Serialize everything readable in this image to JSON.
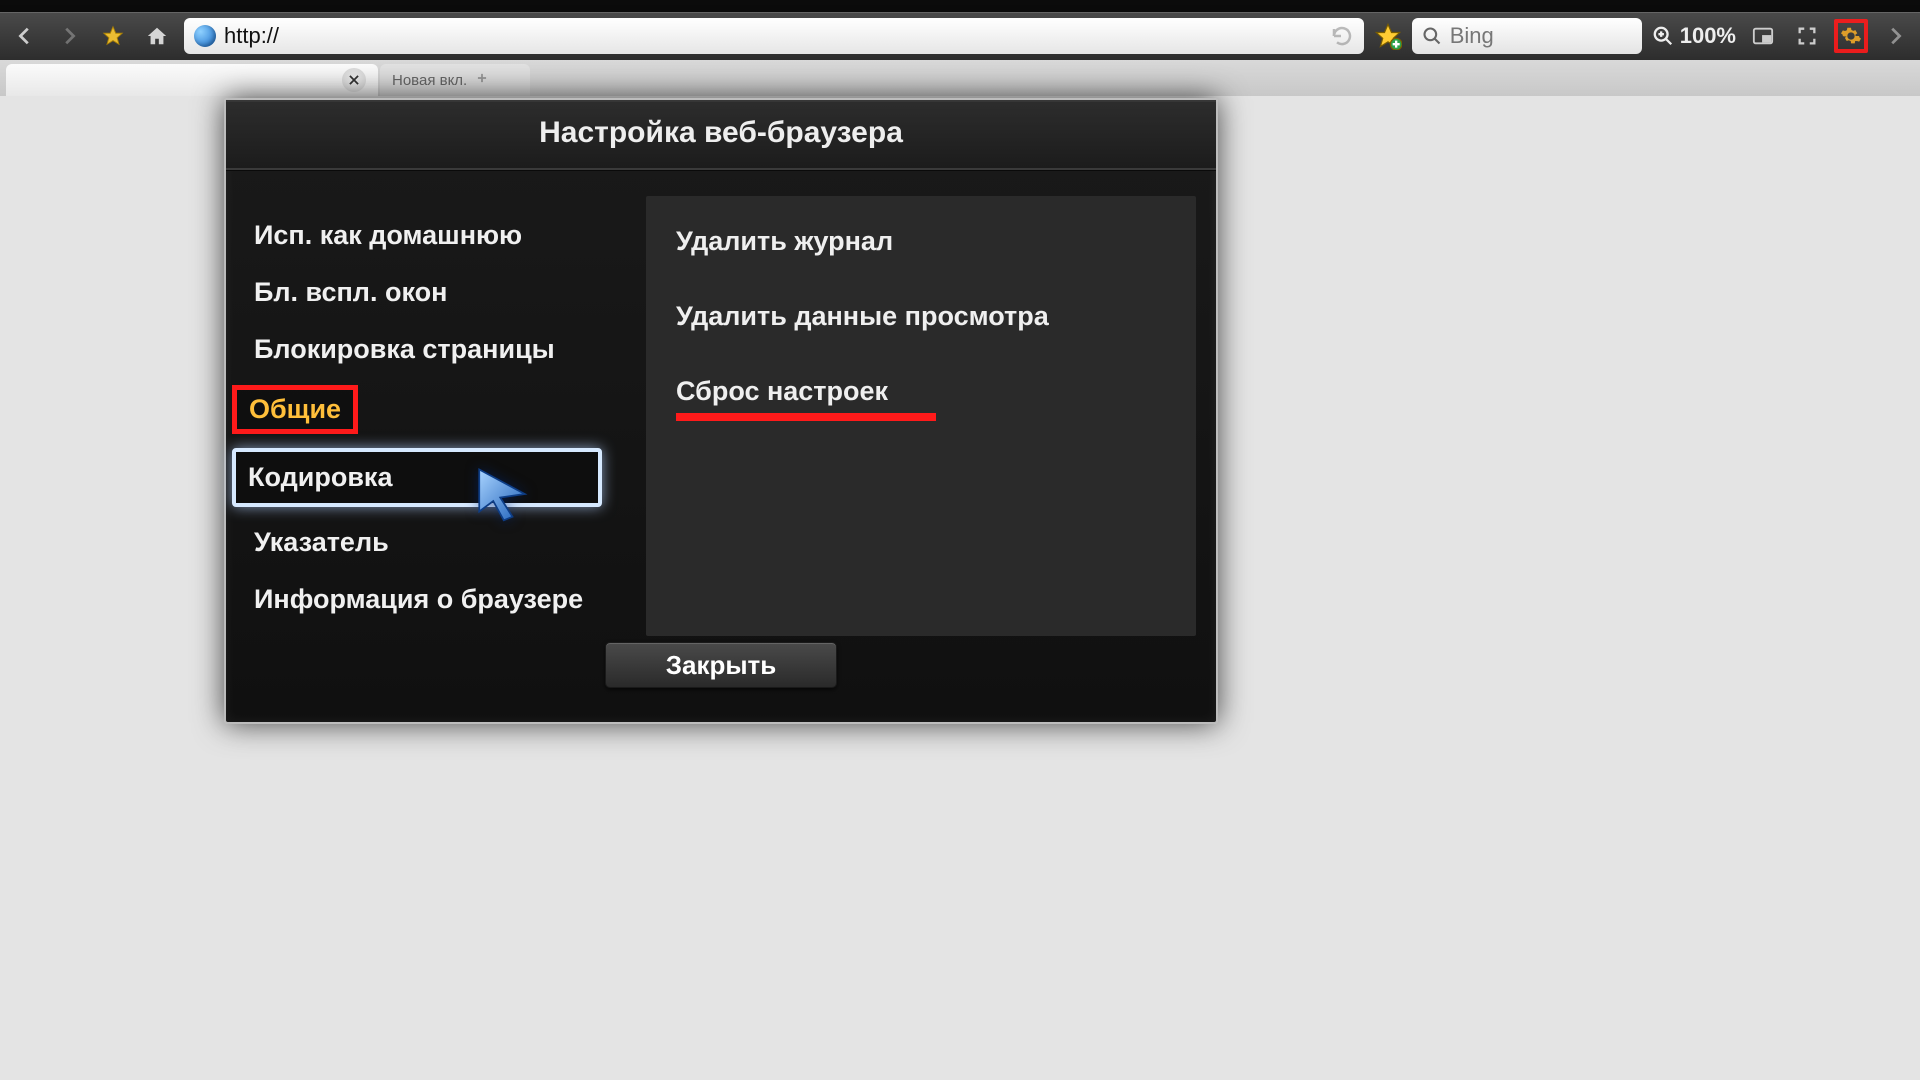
{
  "toolbar": {
    "url_text": "http://",
    "search_placeholder": "Bing",
    "zoom_text": "100%"
  },
  "tabs": {
    "active_title": "",
    "new_tab_label": "Новая вкл."
  },
  "modal": {
    "title": "Настройка веб-браузера",
    "left": {
      "set_homepage": "Исп. как домашнюю",
      "popup_block": "Бл. вспл. окон",
      "page_block": "Блокировка страницы",
      "general": "Общие",
      "encoding": "Кодировка",
      "pointer": "Указатель",
      "about": "Информация о браузере"
    },
    "right": {
      "delete_history": "Удалить журнал",
      "delete_browsing_data": "Удалить данные просмотра",
      "reset_settings": "Сброс настроек"
    },
    "close_label": "Закрыть"
  },
  "colors": {
    "highlight_red": "#ff1a1a",
    "highlight_yellow": "#ffbf3a"
  }
}
